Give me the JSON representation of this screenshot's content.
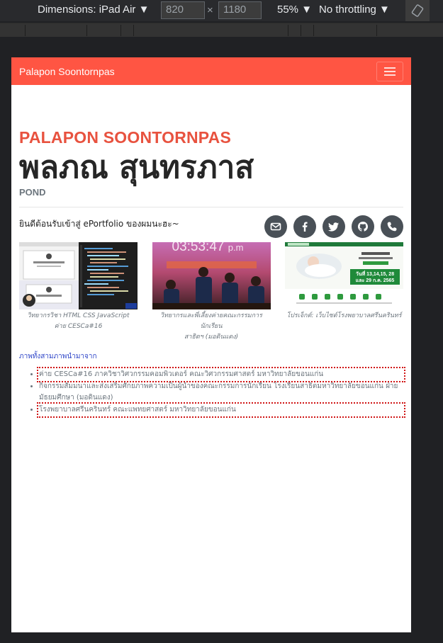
{
  "devtools": {
    "device_label": "Dimensions: iPad Air",
    "width": "820",
    "height": "1180",
    "times": "×",
    "zoom": "55%",
    "throttling": "No throttling"
  },
  "navbar": {
    "brand": "Palapon Soontornpas"
  },
  "header": {
    "name_en": "PALAPON SOONTORNPAS",
    "name_th": "พลภณ สุนทรภาส",
    "nickname": "POND"
  },
  "welcome": "ยินดีต้อนรับเข้าสู่ ePortfolio ของผมนะฮะ~",
  "socials": [
    {
      "icon": "envelope-icon"
    },
    {
      "icon": "facebook-icon"
    },
    {
      "icon": "twitter-icon"
    },
    {
      "icon": "github-icon"
    },
    {
      "icon": "phone-icon"
    }
  ],
  "gallery": [
    {
      "caption_line1": "วิทยากรวิชา HTML CSS JavaScript",
      "caption_line2": "ค่าย CESCa#16"
    },
    {
      "caption_line1": "วิทยากรและพี่เลี้ยงค่ายคณะกรรมการนักเรียน",
      "caption_line2": "สาธิตฯ (มอดินแดง)",
      "overlay_time": "03:53:47",
      "overlay_suffix": "p.m"
    },
    {
      "caption_line1": "โปรเจ็กต์: เว็บไซต์โรงพยาบาลศรีนครินทร์",
      "banner_text": "วันที่ 13,14,15, 28 และ 29 ก.ค. 2565"
    }
  ],
  "source_label": "ภาพทั้งสามภาพนำมาจาก",
  "credits": [
    "ค่าย CESCa#16 ภาควิชาวิศวกรรมคอมพิวเตอร์ คณะวิศวกรรมศาสตร์ มหาวิทยาลัยขอนแก่น",
    "กิจกรรมสัมมนาและส่งเสริมศักยภาพความเป็นผู้นำของคณะกรรมการนักเรียน โรงเรียนสาธิตมหาวิทยาลัยขอนแก่น ฝ่ายมัธยมศึกษา (มอดินแดง)",
    "โรงพยาบาลศรีนครินทร์ คณะแพทยศาสตร์ มหาวิทยาลัยขอนแก่น"
  ],
  "colors": {
    "accent": "#ff5543",
    "name": "#e8523f",
    "social_bg": "#495057",
    "link": "#2f46c8"
  }
}
